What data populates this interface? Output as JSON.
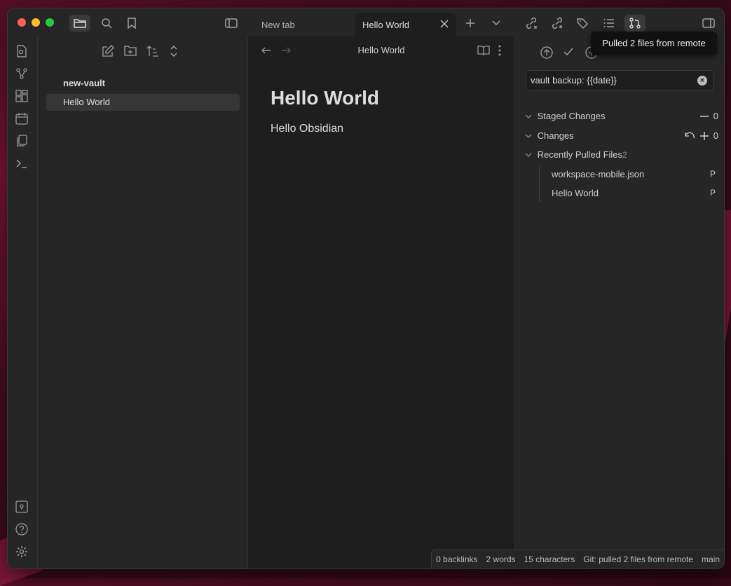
{
  "titlebar": {
    "tabs": [
      {
        "label": "New tab",
        "active": false
      },
      {
        "label": "Hello World",
        "active": true
      }
    ]
  },
  "explorer": {
    "vault_name": "new-vault",
    "files": [
      "Hello World"
    ]
  },
  "editor": {
    "header_title": "Hello World",
    "heading": "Hello World",
    "body": "Hello Obsidian"
  },
  "git": {
    "commit_message": "vault backup: {{date}}",
    "sections": {
      "staged": {
        "label": "Staged Changes",
        "count": "0"
      },
      "changes": {
        "label": "Changes",
        "count": "0"
      },
      "recent": {
        "label": "Recently Pulled Files",
        "count": "2"
      }
    },
    "pulled_files": [
      {
        "name": "workspace-mobile.json",
        "status": "P"
      },
      {
        "name": "Hello World",
        "status": "P"
      }
    ]
  },
  "tooltip": {
    "text": "Pulled 2 files from remote"
  },
  "statusbar": {
    "backlinks": "0 backlinks",
    "words": "2 words",
    "characters": "15 characters",
    "git_status": "Git: pulled 2 files from remote",
    "branch": "main"
  },
  "colors": {
    "window_bg": "#1e1e1e",
    "panel_bg": "#262626",
    "close": "#ff5f57",
    "minimize": "#febc2e",
    "maximize": "#28c840"
  }
}
